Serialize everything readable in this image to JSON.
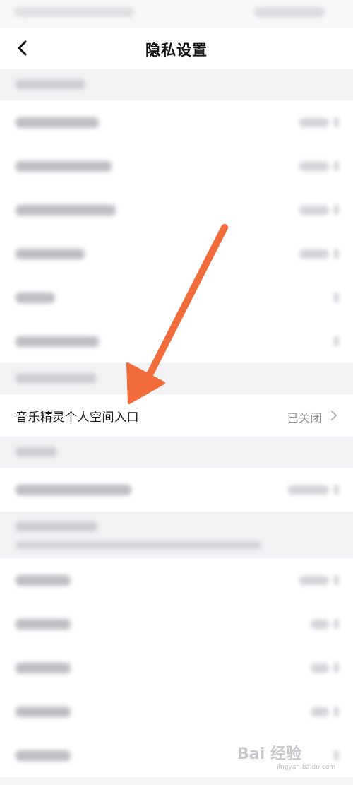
{
  "header": {
    "title": "隐私设置",
    "back_icon": "chevron-left-icon"
  },
  "focused_row": {
    "label": "音乐精灵个人空间入口",
    "value": "已关闭",
    "chevron_icon": "chevron-right-icon"
  },
  "annotation": {
    "arrow_color": "#f26b3a",
    "arrow_icon": "arrow-annotation"
  },
  "watermark": {
    "text": "Bai 经验",
    "url": "jingyan.baidu.com"
  },
  "colors": {
    "background": "#f5f5f7",
    "row_background": "#ffffff",
    "secondary_text": "#8e8e93"
  }
}
